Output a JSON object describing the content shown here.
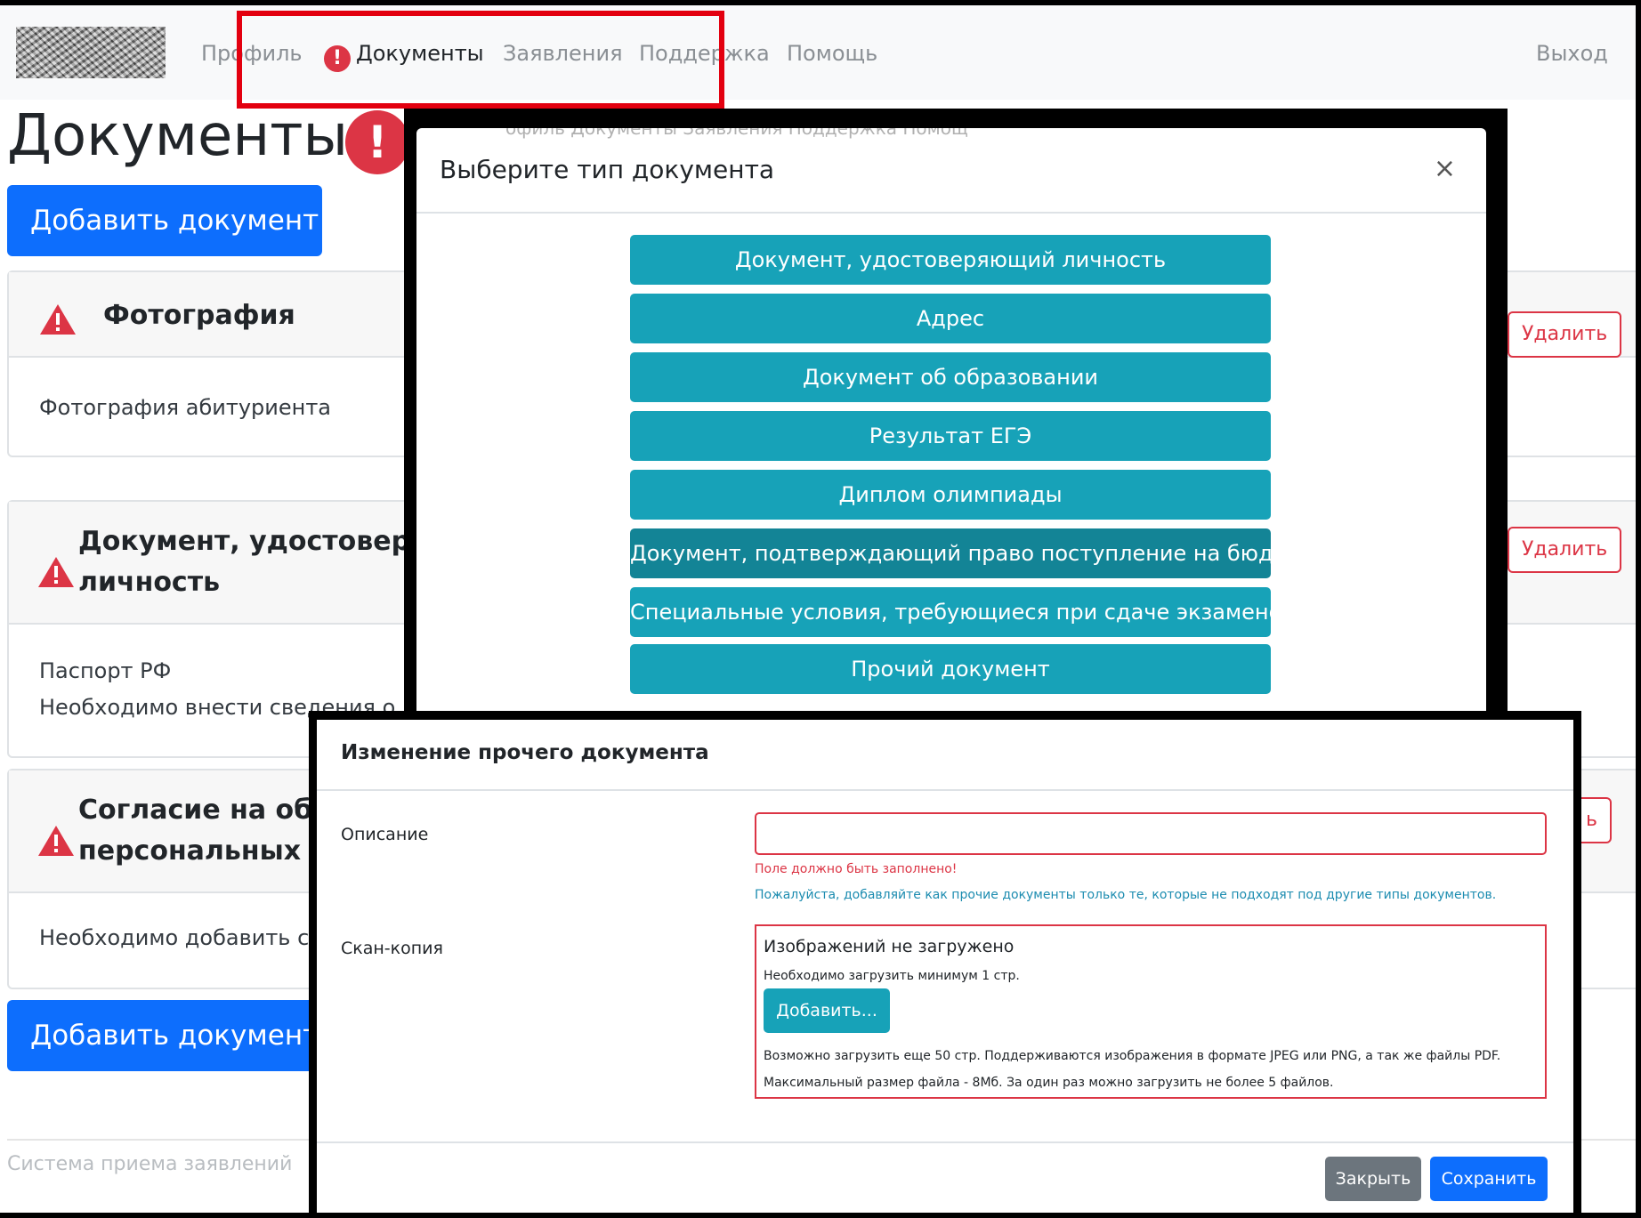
{
  "navbar": {
    "items": [
      {
        "label": "Профиль"
      },
      {
        "label": "Документы",
        "alert": "!"
      },
      {
        "label": "Заявления"
      },
      {
        "label": "Поддержка"
      },
      {
        "label": "Помощь"
      }
    ],
    "logout": "Выход"
  },
  "page": {
    "title": "Документы",
    "title_alert": "!",
    "add_button": "Добавить документ",
    "cards": [
      {
        "title": "Фотография",
        "body": [
          "Фотография абитуриента"
        ],
        "delete": "Удалить"
      },
      {
        "title_line1": "Документ, удостоверяю",
        "title_line2": "личность",
        "body": [
          "Паспорт РФ",
          "Необходимо внести сведения о д"
        ],
        "delete": "Удалить"
      },
      {
        "title_line1": "Согласие на обра",
        "title_line2": "персональных да",
        "body": [
          "Необходимо добавить ск"
        ],
        "delete": "ь"
      }
    ],
    "footer": "Система приема заявлений"
  },
  "modal_type": {
    "title": "Выберите тип документа",
    "close": "×",
    "ghost_nav": "офиль   Документы   Заявления   Поддержка   Помощ",
    "options": [
      "Документ, удостоверяющий личность",
      "Адрес",
      "Документ об образовании",
      "Результат ЕГЭ",
      "Диплом олимпиады",
      "Документ, подтверждающий право поступление на бюджет",
      "Специальные условия, требующиеся при сдаче экзаменов",
      "Прочий документ"
    ]
  },
  "modal_edit": {
    "title": "Изменение прочего документа",
    "description_label": "Описание",
    "description_value": "",
    "description_error": "Поле должно быть заполнено!",
    "description_hint": "Пожалуйста, добавляйте как прочие документы только те, которые не подходят под другие типы документов.",
    "scan_label": "Скан-копия",
    "scan_empty": "Изображений не загружено",
    "scan_min": "Необходимо загрузить минимум 1 стр.",
    "add_button": "Добавить...",
    "info_line1": "Возможно загрузить еще 50 стр. Поддерживаются изображения в формате JPEG или PNG, а так же файлы PDF.",
    "info_line2": "Максимальный размер файла - 8Мб. За один раз можно загрузить не более 5 файлов.",
    "close_button": "Закрыть",
    "save_button": "Сохранить"
  },
  "colors": {
    "primary": "#0d6efd",
    "info": "#17a2b8",
    "danger": "#dc3545",
    "annotation_frame": "#e3000f"
  }
}
